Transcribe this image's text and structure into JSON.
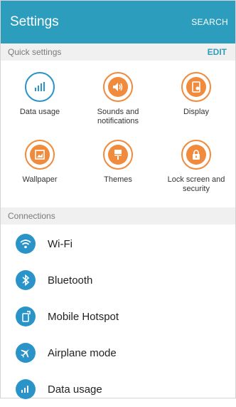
{
  "appbar": {
    "title": "Settings",
    "search_label": "SEARCH"
  },
  "quick_settings": {
    "header": "Quick settings",
    "edit_label": "EDIT",
    "items": [
      {
        "label": "Data usage",
        "icon": "data-usage-icon"
      },
      {
        "label": "Sounds and\nnotifications",
        "icon": "speaker-icon"
      },
      {
        "label": "Display",
        "icon": "display-icon"
      },
      {
        "label": "Wallpaper",
        "icon": "wallpaper-icon"
      },
      {
        "label": "Themes",
        "icon": "paintbrush-icon"
      },
      {
        "label": "Lock screen and\nsecurity",
        "icon": "lock-icon"
      }
    ]
  },
  "connections": {
    "header": "Connections",
    "items": [
      {
        "label": "Wi-Fi",
        "icon": "wifi-icon"
      },
      {
        "label": "Bluetooth",
        "icon": "bluetooth-icon"
      },
      {
        "label": "Mobile Hotspot",
        "icon": "hotspot-icon"
      },
      {
        "label": "Airplane mode",
        "icon": "airplane-icon"
      },
      {
        "label": "Data usage",
        "icon": "data-usage-icon"
      }
    ]
  },
  "colors": {
    "appbar": "#2c9dbd",
    "accent_blue": "#2a93c8",
    "accent_orange": "#f08a3c"
  }
}
